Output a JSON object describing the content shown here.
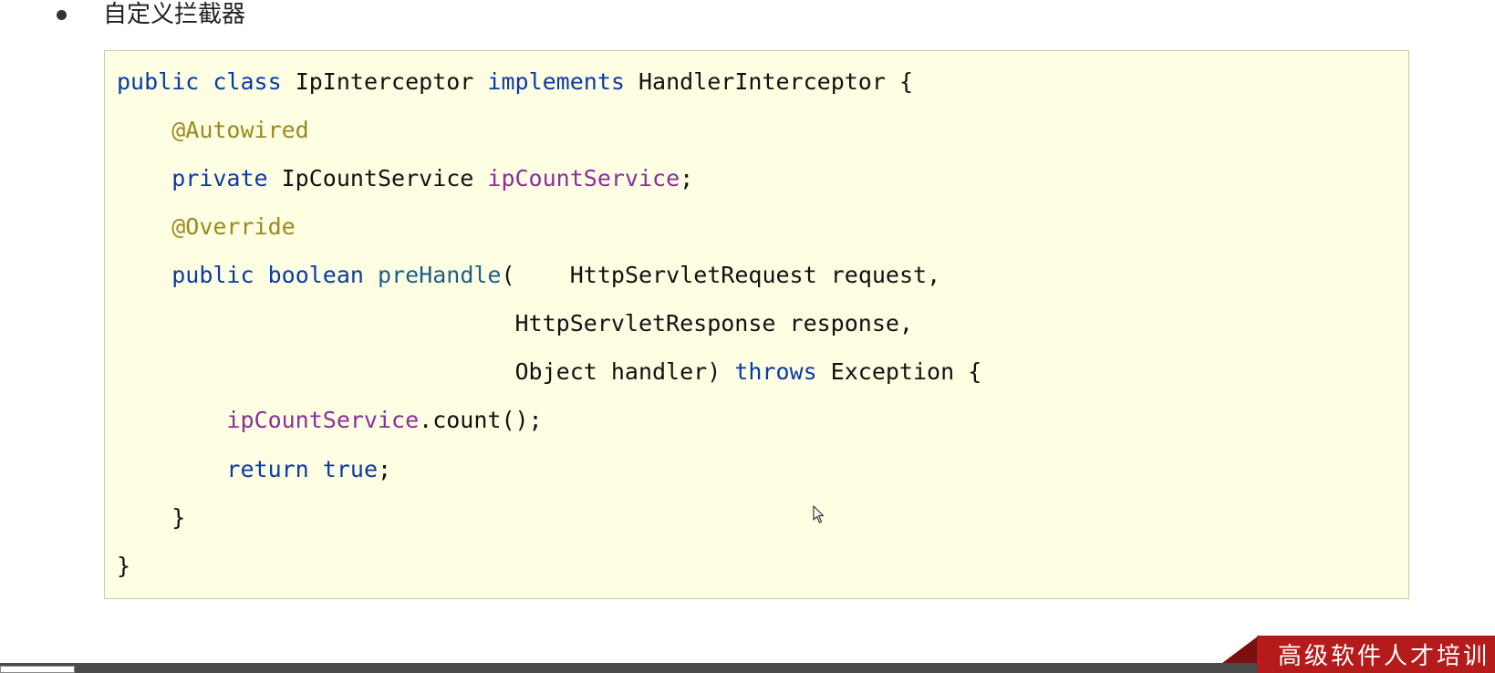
{
  "heading": {
    "bullet_text": "自定义拦截器"
  },
  "code": {
    "lines": [
      [
        {
          "t": "public",
          "c": "kw"
        },
        {
          "t": " ",
          "c": "pl"
        },
        {
          "t": "class",
          "c": "kw"
        },
        {
          "t": " IpInterceptor ",
          "c": "pl"
        },
        {
          "t": "implements",
          "c": "kw"
        },
        {
          "t": " HandlerInterceptor {",
          "c": "pl"
        }
      ],
      [
        {
          "t": "    ",
          "c": "pl"
        },
        {
          "t": "@Autowired",
          "c": "ann"
        }
      ],
      [
        {
          "t": "    ",
          "c": "pl"
        },
        {
          "t": "private",
          "c": "kw"
        },
        {
          "t": " IpCountService ",
          "c": "pl"
        },
        {
          "t": "ipCountService",
          "c": "fld"
        },
        {
          "t": ";",
          "c": "pl"
        }
      ],
      [
        {
          "t": "    ",
          "c": "pl"
        },
        {
          "t": "@Override",
          "c": "ann"
        }
      ],
      [
        {
          "t": "    ",
          "c": "pl"
        },
        {
          "t": "public",
          "c": "kw"
        },
        {
          "t": " ",
          "c": "pl"
        },
        {
          "t": "boolean",
          "c": "kw"
        },
        {
          "t": " ",
          "c": "pl"
        },
        {
          "t": "preHandle",
          "c": "mth"
        },
        {
          "t": "(    HttpServletRequest request,",
          "c": "pl"
        }
      ],
      [
        {
          "t": "                             HttpServletResponse response,",
          "c": "pl"
        }
      ],
      [
        {
          "t": "                             Object handler) ",
          "c": "pl"
        },
        {
          "t": "throws",
          "c": "kw"
        },
        {
          "t": " Exception {",
          "c": "pl"
        }
      ],
      [
        {
          "t": "        ",
          "c": "pl"
        },
        {
          "t": "ipCountService",
          "c": "fld"
        },
        {
          "t": ".count();",
          "c": "pl"
        }
      ],
      [
        {
          "t": "        ",
          "c": "pl"
        },
        {
          "t": "return",
          "c": "kw"
        },
        {
          "t": " ",
          "c": "pl"
        },
        {
          "t": "true",
          "c": "kw"
        },
        {
          "t": ";",
          "c": "pl"
        }
      ],
      [
        {
          "t": "    }",
          "c": "pl"
        }
      ],
      [
        {
          "t": "}",
          "c": "pl"
        }
      ]
    ]
  },
  "banner": {
    "text": "高级软件人才培训"
  },
  "colors": {
    "code_background": "#fefee2",
    "keyword": "#0b3aa8",
    "annotation": "#9b8a1e",
    "field": "#8a2f9b",
    "method": "#1d5f8a",
    "banner": "#b51b1b"
  },
  "icons": {
    "cursor": "mouse-pointer-icon",
    "bullet": "bullet-dot-icon"
  }
}
